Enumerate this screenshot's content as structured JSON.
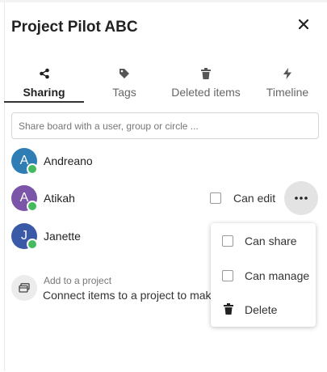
{
  "panel": {
    "title": "Project Pilot ABC",
    "close_icon": "close-icon"
  },
  "tabs": [
    {
      "label": "Sharing",
      "icon": "share-icon",
      "active": true
    },
    {
      "label": "Tags",
      "icon": "tag-icon",
      "active": false
    },
    {
      "label": "Deleted items",
      "icon": "trash-icon",
      "active": false
    },
    {
      "label": "Timeline",
      "icon": "lightning-icon",
      "active": false
    }
  ],
  "search": {
    "placeholder": "Share board with a user, group or circle ...",
    "value": ""
  },
  "shares": [
    {
      "initial": "A",
      "name": "Andreano",
      "avatar_color": "#2f7db5"
    },
    {
      "initial": "A",
      "name": "Atikah",
      "avatar_color": "#7b55a8",
      "permission_label": "Can edit"
    },
    {
      "initial": "J",
      "name": "Janette",
      "avatar_color": "#3a5aa8"
    }
  ],
  "project": {
    "title": "Add to a project",
    "description": "Connect items to a project to make"
  },
  "menu": {
    "items": [
      {
        "label": "Can share",
        "icon": "checkbox"
      },
      {
        "label": "Can manage",
        "icon": "checkbox"
      },
      {
        "label": "Delete",
        "icon": "trash-icon"
      }
    ]
  },
  "colors": {
    "online_status": "#46ba61",
    "active_tab_underline": "#333333"
  }
}
